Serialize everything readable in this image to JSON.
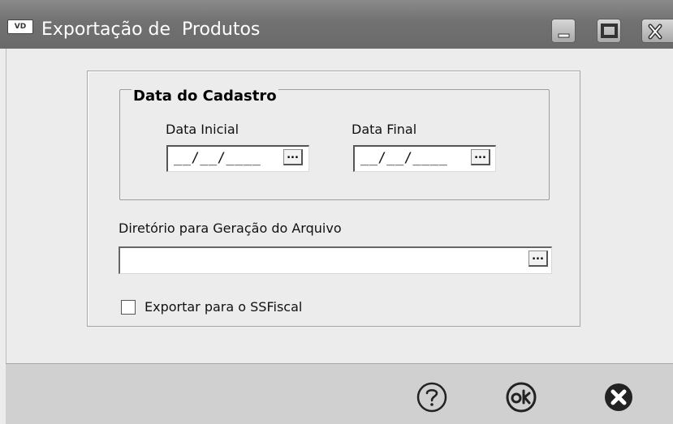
{
  "window": {
    "icon_text": "VD",
    "title": "Exportação de  Produtos"
  },
  "date_group": {
    "title": "Data do Cadastro",
    "start_label": "Data Inicial",
    "start_value": "__/__/____",
    "end_label": "Data Final",
    "end_value": "__/__/____",
    "picker_label": "..."
  },
  "directory": {
    "label": "Diretório para Geração do Arquivo",
    "value": "",
    "browse_label": "..."
  },
  "export_option": {
    "label": "Exportar para o SSFiscal",
    "checked": false
  },
  "footer": {
    "help_icon": "help-icon",
    "ok_icon": "ok-icon",
    "cancel_icon": "cancel-icon"
  }
}
